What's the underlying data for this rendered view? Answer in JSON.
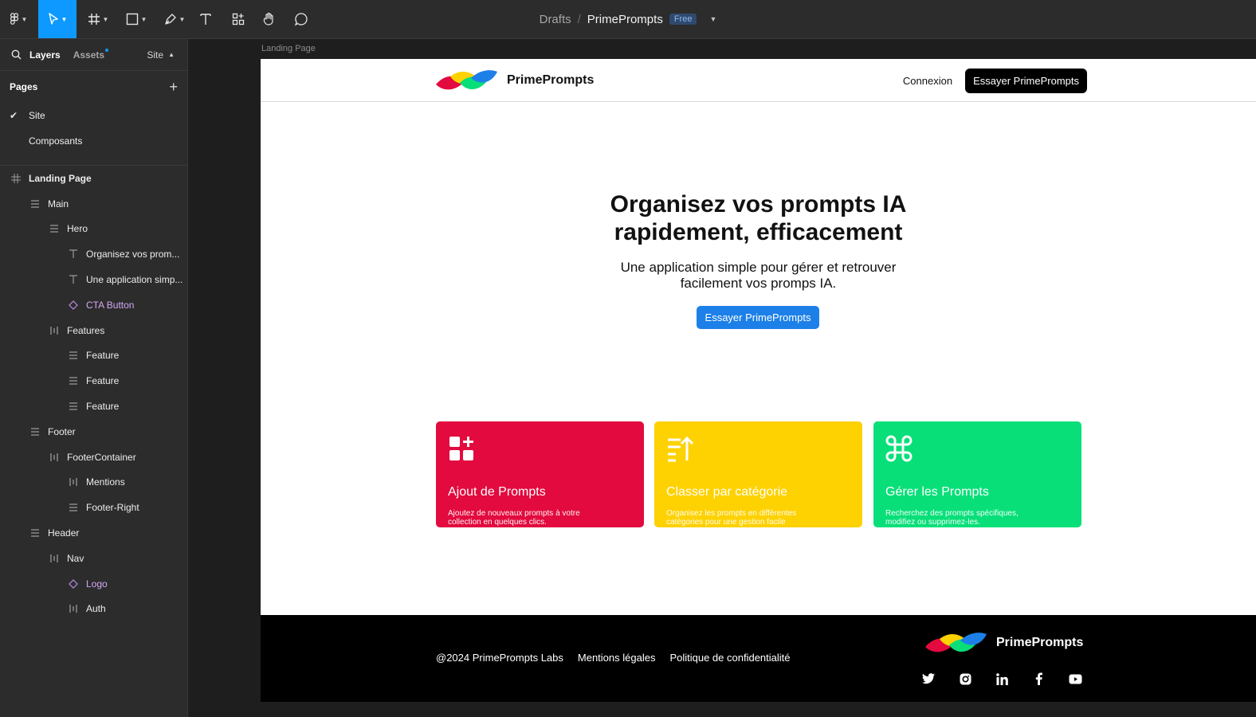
{
  "toolbar": {
    "breadcrumb": {
      "drafts": "Drafts",
      "separator": "/",
      "file": "PrimePrompts",
      "plan_badge": "Free"
    }
  },
  "left_panel": {
    "tabs": {
      "layers": "Layers",
      "assets": "Assets",
      "page_selector": "Site"
    },
    "pages_heading": "Pages",
    "pages": [
      {
        "label": "Site",
        "selected": true
      },
      {
        "label": "Composants",
        "selected": false
      }
    ],
    "layers": [
      {
        "label": "Landing Page",
        "icon": "frame-icon"
      },
      {
        "label": "Main",
        "icon": "auto-layout-vertical-icon"
      },
      {
        "label": "Hero",
        "icon": "auto-layout-vertical-icon"
      },
      {
        "label": "Organisez vos prom...",
        "icon": "text-icon"
      },
      {
        "label": "Une application simp...",
        "icon": "text-icon"
      },
      {
        "label": "CTA Button",
        "icon": "component-instance-icon"
      },
      {
        "label": "Features",
        "icon": "auto-layout-horizontal-icon"
      },
      {
        "label": "Feature",
        "icon": "auto-layout-vertical-icon"
      },
      {
        "label": "Feature",
        "icon": "auto-layout-vertical-icon"
      },
      {
        "label": "Feature",
        "icon": "auto-layout-vertical-icon"
      },
      {
        "label": "Footer",
        "icon": "auto-layout-vertical-icon"
      },
      {
        "label": "FooterContainer",
        "icon": "auto-layout-horizontal-icon"
      },
      {
        "label": "Mentions",
        "icon": "auto-layout-horizontal-icon"
      },
      {
        "label": "Footer-Right",
        "icon": "auto-layout-vertical-icon"
      },
      {
        "label": "Header",
        "icon": "auto-layout-vertical-icon"
      },
      {
        "label": "Nav",
        "icon": "auto-layout-horizontal-icon"
      },
      {
        "label": "Logo",
        "icon": "component-instance-icon"
      },
      {
        "label": "Auth",
        "icon": "auto-layout-horizontal-icon"
      }
    ]
  },
  "canvas": {
    "frame_label": "Landing Page",
    "site": {
      "header": {
        "brand": "PrimePrompts",
        "login": "Connexion",
        "cta": "Essayer PrimePrompts"
      },
      "hero": {
        "title_line1": "Organisez vos prompts IA",
        "title_line2": "rapidement, efficacement",
        "subtitle_line1": "Une application simple pour gérer et retrouver",
        "subtitle_line2": "facilement vos promps IA.",
        "cta": "Essayer PrimePrompts"
      },
      "features": [
        {
          "title": "Ajout de Prompts",
          "desc": "Ajoutez de nouveaux prompts à votre collection en quelques clics.",
          "color": "#e20a3e",
          "icon": "grid-plus-icon"
        },
        {
          "title": "Classer par catégorie",
          "desc": "Organisez les prompts en différentes catégories pour une gestion facile",
          "color": "#fed100",
          "icon": "sort-ascending-icon"
        },
        {
          "title": "Gérer les Prompts",
          "desc": "Recherchez des prompts spécifiques, modifiez ou supprimez-les.",
          "color": "#08df79",
          "icon": "command-icon"
        }
      ],
      "footer": {
        "copyright": "@2024 PrimePrompts Labs",
        "legal": "Mentions légales",
        "privacy": "Politique de confidentialité",
        "brand": "PrimePrompts",
        "socials": [
          "twitter-icon",
          "instagram-icon",
          "linkedin-icon",
          "facebook-icon",
          "youtube-icon"
        ]
      }
    }
  },
  "colors": {
    "accent": "#0d99ff",
    "cta_blue": "#1d80e8",
    "component_purple": "#d3a8f5"
  }
}
